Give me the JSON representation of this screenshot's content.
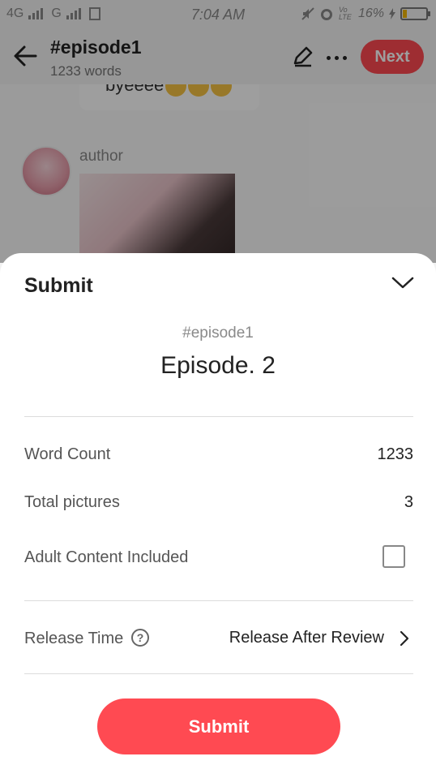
{
  "status_bar": {
    "network_left": "4G",
    "network_mid": "G",
    "time": "7:04 AM",
    "volte": "Vo LTE",
    "battery_percent": "16%",
    "battery_level": 0.16
  },
  "header": {
    "title": "#episode1",
    "subtitle": "1233 words",
    "next_label": "Next"
  },
  "background": {
    "message_text": "byeeee",
    "author_name": "author"
  },
  "sheet": {
    "title": "Submit",
    "episode_tag": "#episode1",
    "episode_title": "Episode. 2",
    "rows": [
      {
        "label": "Word Count",
        "value": "1233"
      },
      {
        "label": "Total pictures",
        "value": "3"
      },
      {
        "label": "Adult Content Included",
        "checked": false
      }
    ],
    "release_label": "Release Time",
    "release_help": "?",
    "release_value": "Release After Review",
    "submit_label": "Submit"
  },
  "colors": {
    "accent": "#ff4a52",
    "overlay": "rgba(0,0,0,0.38)"
  },
  "icons": [
    "back-arrow-icon",
    "edit-pencil-icon",
    "more-dots-icon",
    "chevron-down-icon",
    "help-icon",
    "chevron-right-icon",
    "alarm-icon",
    "mute-icon"
  ]
}
